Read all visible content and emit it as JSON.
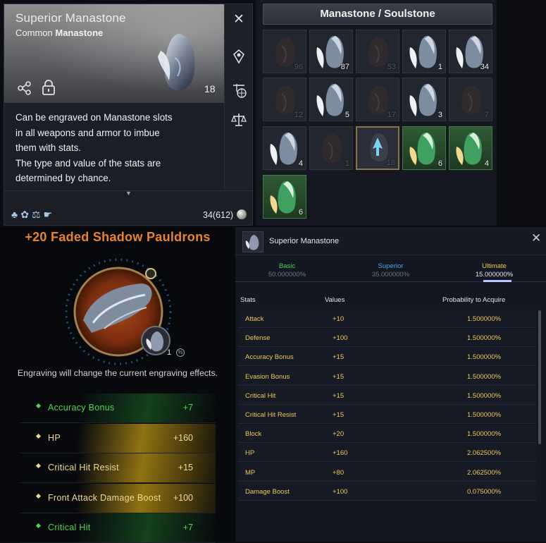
{
  "tooltip": {
    "item_name": "Superior Manastone",
    "grade_prefix": "Common ",
    "grade_type": "Manastone",
    "quantity": "18",
    "description_lines": [
      "Can be engraved on Manastone slots",
      "in all weapons and armor to imbue",
      "them with stats.",
      "The type and value of the stats are",
      "determined by chance."
    ],
    "currency_count": "34(612)",
    "close_label": "✕",
    "side_icons": [
      "locate-icon",
      "trade-world-icon",
      "scale-icon"
    ],
    "footer_icons": [
      "party-icon",
      "guild-icon",
      "scale-icon",
      "hand-icon"
    ]
  },
  "inventory": {
    "title": "Manastone / Soulstone",
    "slots": [
      {
        "qty": "96",
        "kind": "dark-stone",
        "dim": true
      },
      {
        "qty": "87",
        "kind": "blue-stone",
        "dim": false
      },
      {
        "qty": "53",
        "kind": "dark-stone",
        "dim": true
      },
      {
        "qty": "1",
        "kind": "blue-stone",
        "dim": false
      },
      {
        "qty": "34",
        "kind": "blue-stone",
        "dim": false
      },
      {
        "qty": "12",
        "kind": "dark-stone",
        "dim": true
      },
      {
        "qty": "5",
        "kind": "blue-stone",
        "dim": false
      },
      {
        "qty": "17",
        "kind": "dark-stone",
        "dim": true
      },
      {
        "qty": "3",
        "kind": "blue-stone",
        "dim": false
      },
      {
        "qty": "7",
        "kind": "dark-stone",
        "dim": true
      },
      {
        "qty": "4",
        "kind": "blue-stone",
        "dim": false
      },
      {
        "qty": "1",
        "kind": "dark-stone",
        "dim": true
      },
      {
        "qty": "18",
        "kind": "selected-stone",
        "dim": true
      },
      {
        "qty": "6",
        "kind": "green-stone",
        "dim": false
      },
      {
        "qty": "4",
        "kind": "green-stone",
        "dim": false
      },
      {
        "qty": "6",
        "kind": "green-stone",
        "dim": false
      }
    ]
  },
  "item_panel": {
    "title": "+20 Faded Shadow Pauldrons",
    "socket_qty": "1",
    "engrave_note": "Engraving will change the current engraving effects.",
    "effects": [
      {
        "name": "Accuracy Bonus",
        "value": "+7",
        "tier": "green"
      },
      {
        "name": "HP",
        "value": "+160",
        "tier": "gold"
      },
      {
        "name": "Critical Hit Resist",
        "value": "+15",
        "tier": "gold"
      },
      {
        "name": "Front Attack Damage Boost",
        "value": "+100",
        "tier": "gold"
      },
      {
        "name": "Critical Hit",
        "value": "+7",
        "tier": "green"
      }
    ]
  },
  "probability": {
    "item_name": "Superior Manastone",
    "close_label": "✕",
    "tiers": [
      {
        "name": "Basic",
        "value": "50.000000%",
        "color": "#4fd34f"
      },
      {
        "name": "Superior",
        "value": "35.000000%",
        "color": "#4aa6e8"
      },
      {
        "name": "Ultimate",
        "value": "15.000000%",
        "color": "#f2c94c"
      }
    ],
    "columns": {
      "stats": "Stats",
      "values": "Values",
      "probability": "Probability to Acquire"
    },
    "rows": [
      {
        "stat": "Attack",
        "value": "+10",
        "prob": "1.500000%"
      },
      {
        "stat": "Defense",
        "value": "+100",
        "prob": "1.500000%"
      },
      {
        "stat": "Accuracy Bonus",
        "value": "+15",
        "prob": "1.500000%"
      },
      {
        "stat": "Evasion Bonus",
        "value": "+15",
        "prob": "1.500000%"
      },
      {
        "stat": "Critical Hit",
        "value": "+15",
        "prob": "1.500000%"
      },
      {
        "stat": "Critical Hit Resist",
        "value": "+15",
        "prob": "1.500000%"
      },
      {
        "stat": "Block",
        "value": "+20",
        "prob": "1.500000%"
      },
      {
        "stat": "HP",
        "value": "+160",
        "prob": "2.062500%"
      },
      {
        "stat": "MP",
        "value": "+80",
        "prob": "2.062500%"
      },
      {
        "stat": "Damage Boost",
        "value": "+100",
        "prob": "0.075000%"
      }
    ]
  }
}
